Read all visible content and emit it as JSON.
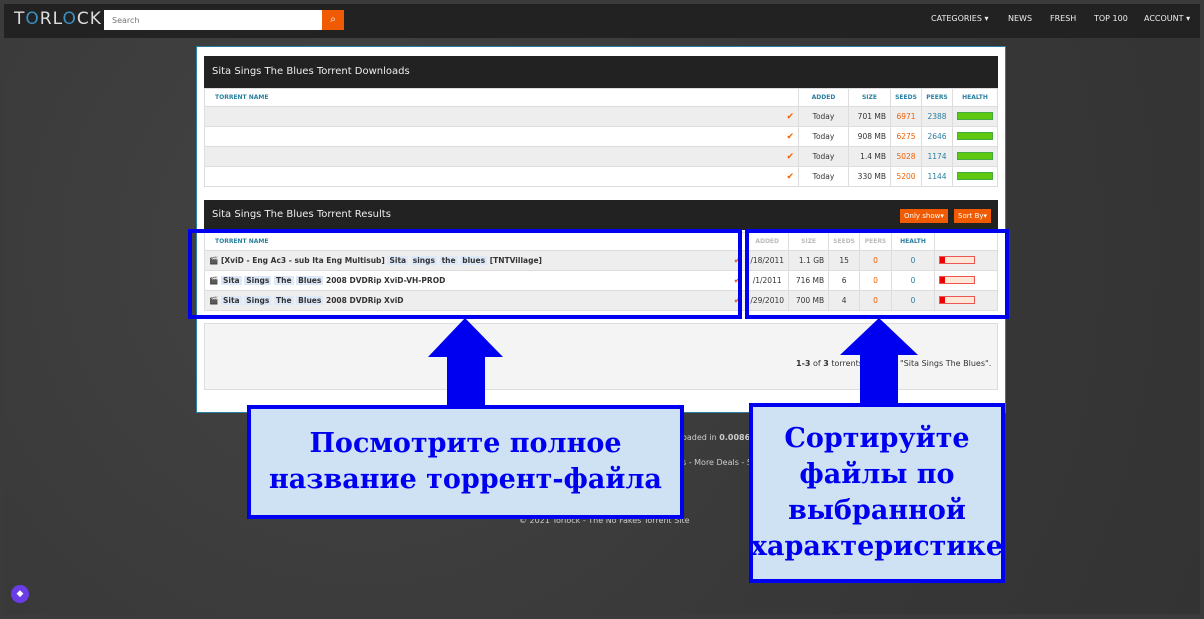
{
  "header": {
    "logo": "TORLOCK",
    "search_placeholder": "Search",
    "nav": [
      "CATEGORIES ▾",
      "NEWS",
      "FRESH",
      "TOP 100",
      "ACCOUNT ▾"
    ]
  },
  "downloads": {
    "title": "Sita Sings The Blues Torrent Downloads",
    "columns": [
      "TORRENT NAME",
      "ADDED",
      "SIZE",
      "SEEDS",
      "PEERS",
      "HEALTH"
    ],
    "rows": [
      {
        "added": "Today",
        "size": "701 MB",
        "seeds": "6971",
        "peers": "2388"
      },
      {
        "added": "Today",
        "size": "908 MB",
        "seeds": "6275",
        "peers": "2646"
      },
      {
        "added": "Today",
        "size": "1.4 MB",
        "seeds": "5028",
        "peers": "1174"
      },
      {
        "added": "Today",
        "size": "330 MB",
        "seeds": "5200",
        "peers": "1144"
      }
    ]
  },
  "results": {
    "title": "Sita Sings The Blues Torrent Results",
    "only_show": "Only show▾",
    "sort_by": "Sort By▾",
    "columns": [
      "TORRENT NAME",
      "ADDED",
      "SIZE",
      "SEEDS",
      "PEERS",
      "HEALTH"
    ],
    "rows": [
      {
        "pre": "[XviD - Eng Ac3 - sub Ita Eng Multisub]",
        "hl": [
          "Sita",
          "sings",
          "the",
          "blues"
        ],
        "post": "[TNTVillage]",
        "added": "/18/2011",
        "size": "1.1 GB",
        "seeds": "15",
        "peers": "0",
        "health": "0"
      },
      {
        "pre": "",
        "hl": [
          "Sita",
          "Sings",
          "The",
          "Blues"
        ],
        "post": "2008 DVDRip XviD-VH-PROD",
        "added": "/1/2011",
        "size": "716 MB",
        "seeds": "6",
        "peers": "0",
        "health": "0"
      },
      {
        "pre": "",
        "hl": [
          "Sita",
          "Sings",
          "The",
          "Blues"
        ],
        "post": "2008 DVDRip XviD",
        "added": "/29/2010",
        "size": "700 MB",
        "seeds": "4",
        "peers": "0",
        "health": "0"
      }
    ],
    "summary_a": "1-3",
    "summary_b": " of ",
    "summary_c": "3",
    "summary_d": " torrents",
    "summary_e": "\"Sita Sings The Blues\"."
  },
  "footer": {
    "loaded": "oaded in ",
    "loaded_val": "0.0086",
    "links": "s - More Deals - S",
    "copyright": "© 2021 Torlock - The No Fakes Torrent Site"
  },
  "callouts": {
    "left": "Посмотрите полное название торрент-файла",
    "right": "Сортируйте файлы по выбранной характеристике"
  },
  "colors": {
    "accent": "#f05a00",
    "annotation": "#0000f0",
    "callout_fill": "#cfe2f3"
  }
}
